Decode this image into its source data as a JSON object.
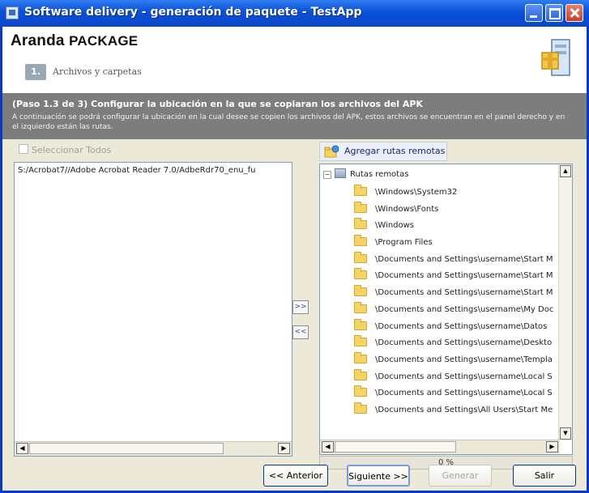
{
  "window": {
    "title": "Software delivery - generación de paquete - TestApp"
  },
  "header": {
    "brand_name": "Aranda",
    "brand_product": "PACKAGE",
    "step_number": "1.",
    "step_label": "Archivos y carpetas"
  },
  "banner": {
    "title": "(Paso 1.3 de 3) Configurar la ubicación en la que se copiaran los archivos del APK",
    "description": "A continuación se podrá configurar la ubicación en la cual desee se copien los archivos del APK, estos archivos se encuentran en el panel derecho y en el izquierdo están las rutas."
  },
  "left": {
    "select_all": "Seleccionar Todos",
    "files": [
      "S:/Acrobat7//Adobe Acrobat Reader 7.0/AdbeRdr70_enu_fu"
    ]
  },
  "transfer": {
    "add": ">>",
    "remove": "<<"
  },
  "right": {
    "add_remote_label": "Agregar rutas remotas",
    "root_label": "Rutas remotas",
    "paths": [
      "\\Windows\\System32",
      "\\Windows\\Fonts",
      "\\Windows",
      "\\Program Files",
      "\\Documents and Settings\\username\\Start M",
      "\\Documents and Settings\\username\\Start M",
      "\\Documents and Settings\\username\\Start M",
      "\\Documents and Settings\\username\\My Doc",
      "\\Documents and Settings\\username\\Datos",
      "\\Documents and Settings\\username\\Deskto",
      "\\Documents and Settings\\username\\Templa",
      "\\Documents and Settings\\username\\Local S",
      "\\Documents and Settings\\username\\Local S",
      "\\Documents and Settings\\All Users\\Start Me"
    ]
  },
  "progress": {
    "text": "0 %",
    "value": 0
  },
  "buttons": {
    "back": "<< Anterior",
    "next": "Siguiente >>",
    "generate": "Generar",
    "exit": "Salir"
  }
}
